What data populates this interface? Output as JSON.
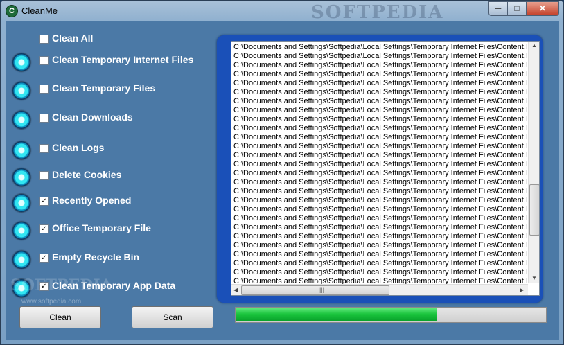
{
  "window": {
    "title": "CleanMe",
    "watermark": "SOFTPEDIA"
  },
  "titlebar": {
    "app_icon_glyph": "C",
    "min": "─",
    "max": "□",
    "close": "✕"
  },
  "options": [
    {
      "label": "Clean All",
      "checked": false,
      "has_led": false
    },
    {
      "label": "Clean Temporary Internet Files",
      "checked": false,
      "has_led": true
    },
    {
      "label": "Clean Temporary Files",
      "checked": false,
      "has_led": true
    },
    {
      "label": "Clean Downloads",
      "checked": false,
      "has_led": true
    },
    {
      "label": "Clean Logs",
      "checked": false,
      "has_led": true
    },
    {
      "label": "Delete Cookies",
      "checked": false,
      "has_led": true
    },
    {
      "label": "Recently Opened",
      "checked": true,
      "has_led": true
    },
    {
      "label": "Office Temporary File",
      "checked": true,
      "has_led": true
    },
    {
      "label": "Empty Recycle Bin",
      "checked": true,
      "has_led": true
    },
    {
      "label": "Clean Temporary App Data",
      "checked": true,
      "has_led": true
    }
  ],
  "check_glyph": "✓",
  "buttons": {
    "clean": "Clean",
    "scan": "Scan"
  },
  "log": {
    "line": "C:\\Documents and Settings\\Softpedia\\Local Settings\\Temporary Internet Files\\Content.IE",
    "count": 27
  },
  "scroll": {
    "up": "▲",
    "down": "▼",
    "left": "◀",
    "right": "▶",
    "grip": "|||"
  },
  "progress": {
    "percent": 65
  },
  "branding": {
    "watermark_logo": "SOFTPEDIA",
    "watermark_url": "www.softpedia.com"
  },
  "colors": {
    "led": "#31e6f2",
    "panel": "#1a50b8",
    "progress": "#19c33c",
    "client": "#4b79a6"
  }
}
